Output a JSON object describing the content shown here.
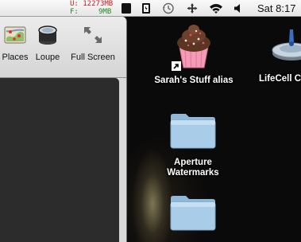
{
  "menubar": {
    "memory": {
      "used_label": "U:",
      "used_value": "12273MB",
      "free_label": "F:",
      "free_value": "9MB"
    },
    "icons": [
      "black-square-icon",
      "battery-icon",
      "time-machine-icon",
      "move-arrows-icon",
      "wifi-icon",
      "volume-icon"
    ],
    "clock": "Sat 8:17"
  },
  "toolbar": {
    "items": [
      {
        "label": "Places",
        "icon": "map-icon"
      },
      {
        "label": "Loupe",
        "icon": "loupe-icon"
      },
      {
        "label": "Full Screen",
        "icon": "full-screen-icon"
      }
    ]
  },
  "desktop": {
    "icons": [
      {
        "name": "Sarah's Stuff alias",
        "icon": "cupcake-icon"
      },
      {
        "name": "LifeCell C",
        "icon": "drive-icon"
      },
      {
        "name_line1": "Aperture",
        "name_line2": "Watermarks",
        "icon": "folder-icon"
      },
      {
        "name": "",
        "icon": "folder-icon"
      }
    ]
  },
  "colors": {
    "memory_used": "#c0181e",
    "memory_free": "#1c8a1c",
    "folder": "#a9cde9"
  }
}
